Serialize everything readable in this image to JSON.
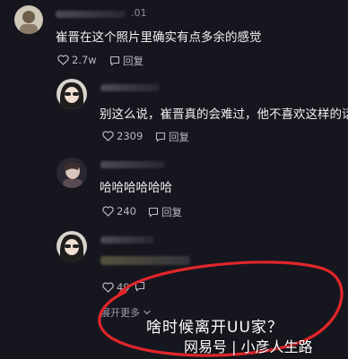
{
  "colors": {
    "background": "#16161e",
    "annotation": "#e0262b",
    "text": "#f1f1f4",
    "muted": "#8f8f98"
  },
  "comments": [
    {
      "id": "c1",
      "time_fragment": ".01",
      "text": "崔晋在这个照片里确实有点多余的感觉",
      "likes": "2.7w",
      "reply_label": "回复"
    },
    {
      "id": "c2",
      "text": "别这么说，崔晋真的会难过，他不喜欢这样的话",
      "likes": "2309",
      "reply_label": "回复"
    },
    {
      "id": "c3",
      "text": "哈哈哈哈哈哈",
      "likes": "240",
      "reply_label": "回复"
    },
    {
      "id": "c4",
      "likes": "49",
      "reply_label": ""
    }
  ],
  "expand_more": "展开更多",
  "annotation_caption": "啥时候离开UU家？",
  "watermark": "网易号 | 小彦人生路",
  "icons": {
    "like": "heart-outline-icon",
    "reply": "comment-bubble-icon",
    "expand": "chevron-down-icon"
  }
}
